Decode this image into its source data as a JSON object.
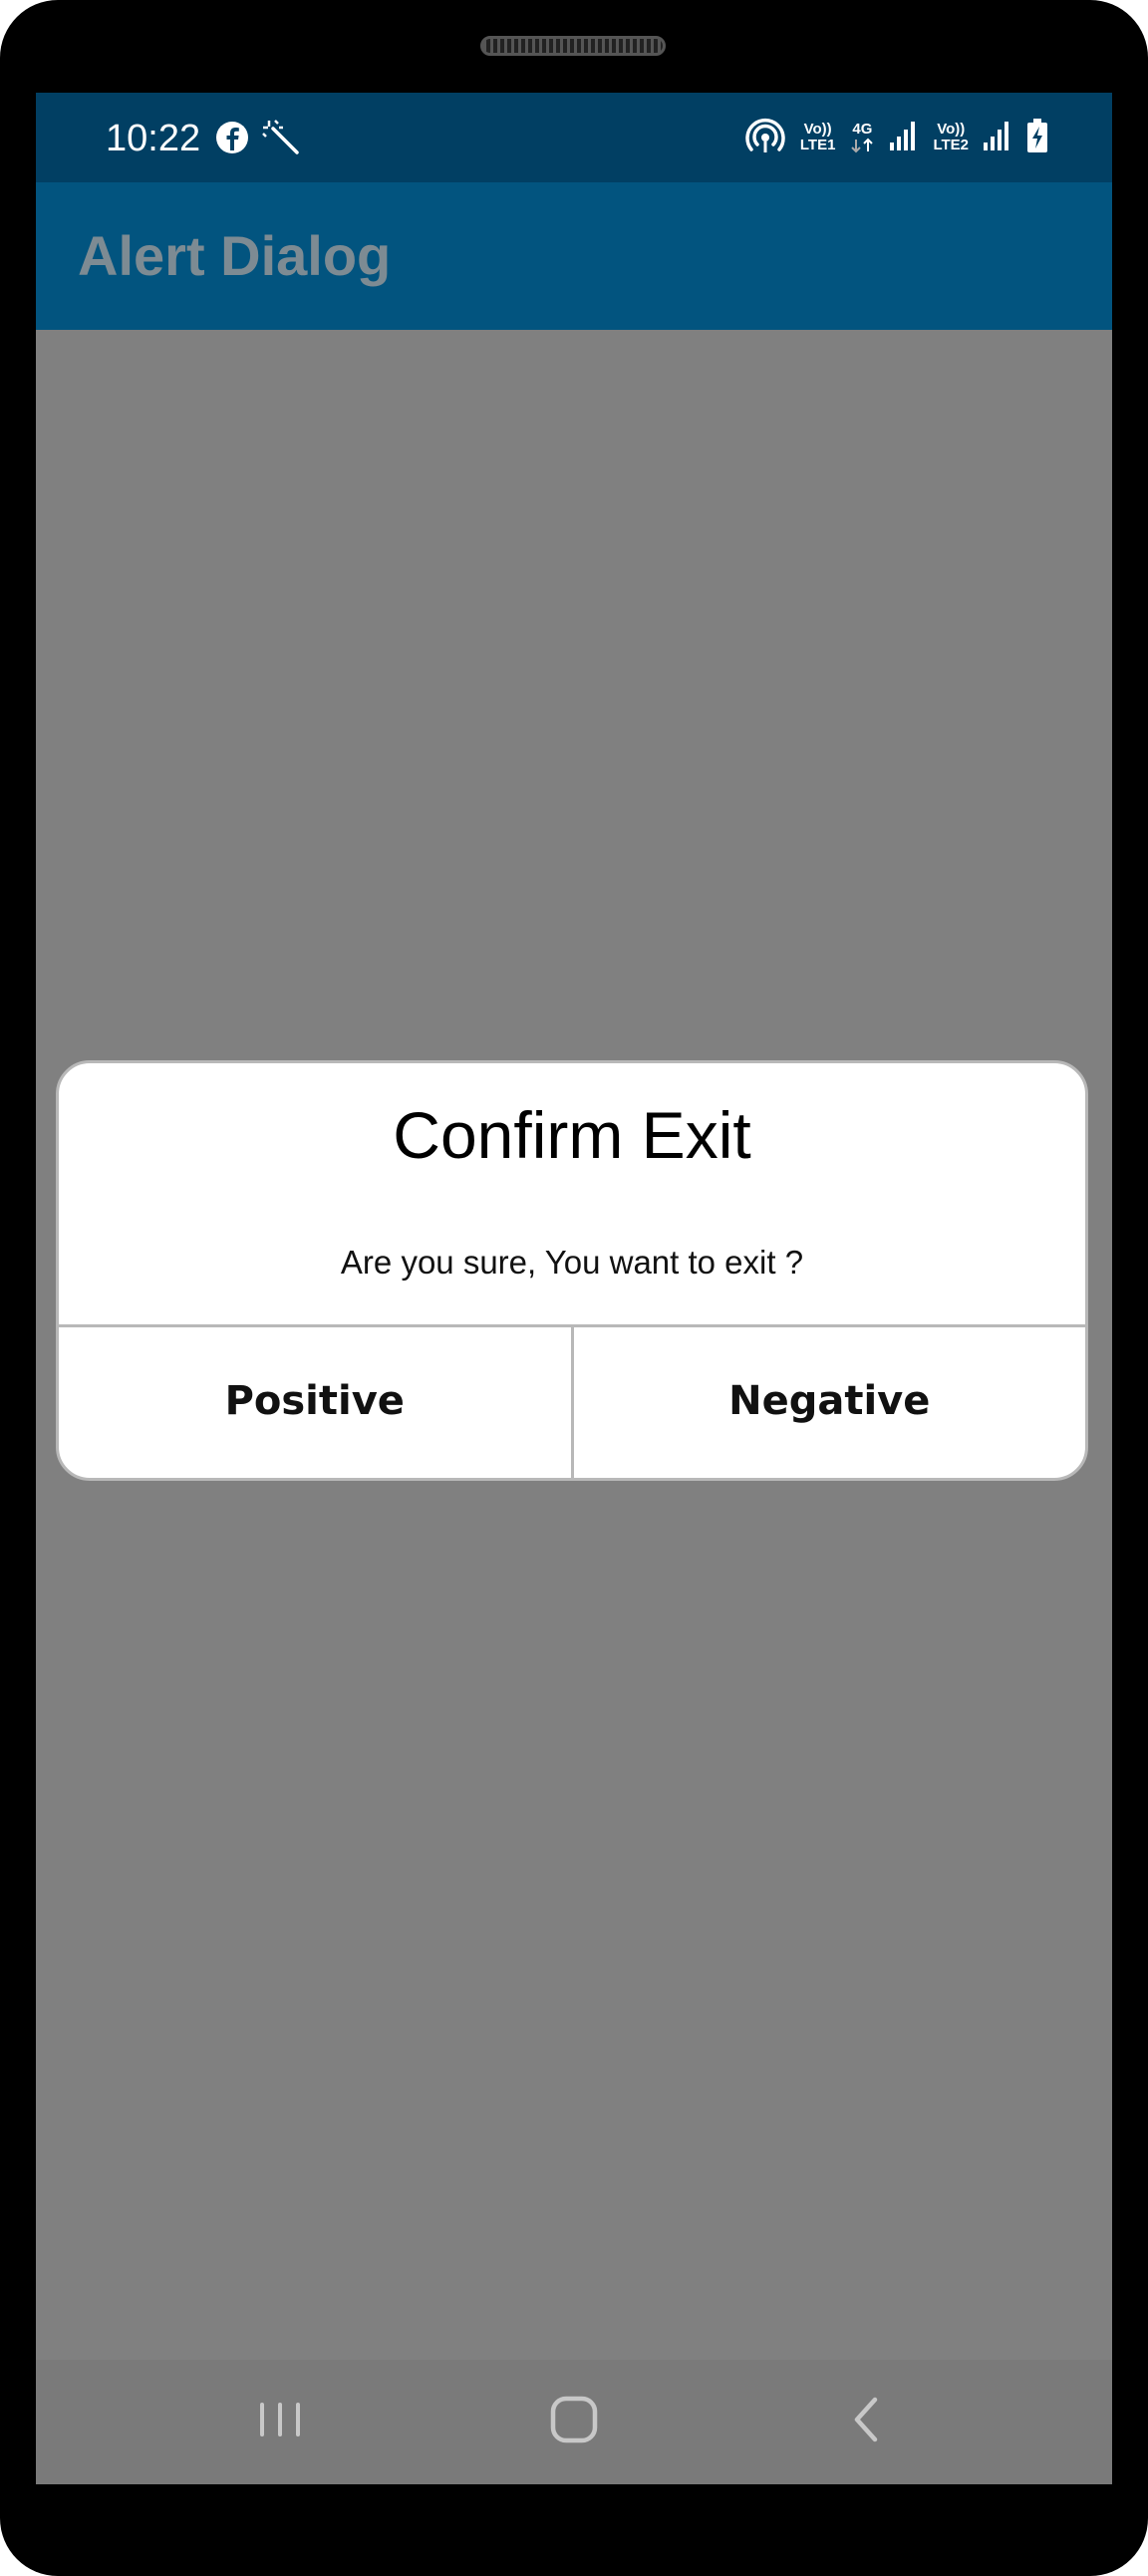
{
  "status_bar": {
    "time": "10:22",
    "left_icons": [
      "facebook-icon",
      "magic-wand-icon"
    ],
    "right_icons": [
      "hotspot-icon",
      "volte-lte1-icon",
      "4g-data-icon",
      "signal-1-icon",
      "volte-lte2-icon",
      "signal-2-icon",
      "battery-charging-icon"
    ],
    "lte1_top": "Vo))",
    "lte1_bottom": "LTE1",
    "data_label": "4G",
    "lte2_top": "Vo))",
    "lte2_bottom": "LTE2"
  },
  "app_bar": {
    "title": "Alert Dialog"
  },
  "dialog": {
    "title": "Confirm Exit",
    "message": "Are you sure, You want to exit ?",
    "positive_label": "Positive",
    "negative_label": "Negative"
  },
  "nav_bar": {
    "icons": [
      "recents-icon",
      "home-icon",
      "back-icon"
    ]
  },
  "colors": {
    "status_bar": "#013f63",
    "app_bar": "#02547f",
    "scrim": "#808080",
    "dialog_bg": "#ffffff"
  }
}
